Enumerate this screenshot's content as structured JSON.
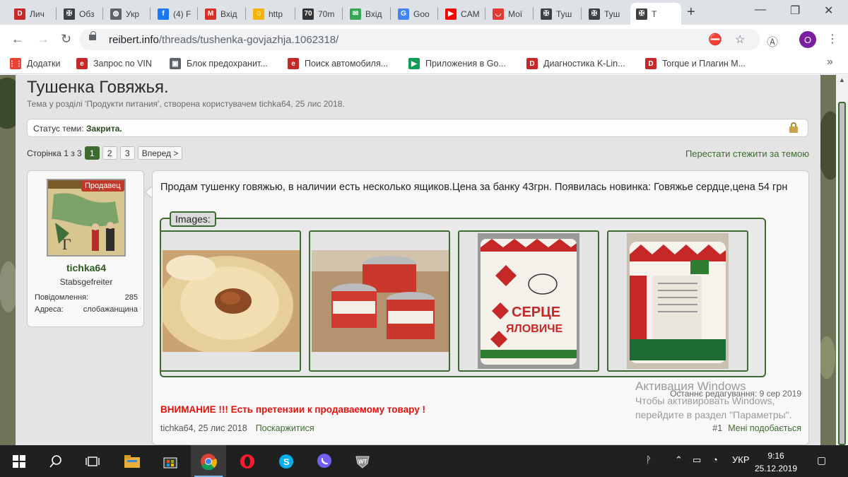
{
  "browser": {
    "tabs": [
      {
        "label": "Лич",
        "fav": "D",
        "color": "#c62828"
      },
      {
        "label": "Обз",
        "fav": "✠",
        "color": "#3c4043"
      },
      {
        "label": "Укр",
        "fav": "◍",
        "color": "#5f6368"
      },
      {
        "label": "(4) F",
        "fav": "f",
        "color": "#1877f2"
      },
      {
        "label": "Вхід",
        "fav": "M",
        "color": "#d93025"
      },
      {
        "label": "http",
        "fav": "☺",
        "color": "#f4b400"
      },
      {
        "label": "70m",
        "fav": "70",
        "color": "#333333"
      },
      {
        "label": "Вхід",
        "fav": "✉",
        "color": "#34a853"
      },
      {
        "label": "Goo",
        "fav": "G",
        "color": "#4285f4"
      },
      {
        "label": "CAM",
        "fav": "▶",
        "color": "#ff0000"
      },
      {
        "label": "Мої",
        "fav": "◡",
        "color": "#e53935"
      },
      {
        "label": "Туш",
        "fav": "✠",
        "color": "#3c4043"
      },
      {
        "label": "Туш",
        "fav": "✠",
        "color": "#3c4043"
      },
      {
        "label": "Т",
        "fav": "✠",
        "color": "#3c4043"
      }
    ],
    "new_tab": "+",
    "window_controls": {
      "minimize": "—",
      "maximize": "❐",
      "close": "✕"
    },
    "nav": {
      "back": "←",
      "forward": "→",
      "reload": "↻"
    },
    "url_host": "reibert.info",
    "url_path": "/threads/tushenka-govjazhja.1062318/",
    "profile_initial": "O",
    "bookmarks": [
      {
        "label": "Додатки",
        "icon": "apps-icon"
      },
      {
        "label": "Запрос по VIN",
        "icon": "e-icon"
      },
      {
        "label": "Блок предохранит...",
        "icon": "car-icon"
      },
      {
        "label": "Поиск автомобиля...",
        "icon": "e-icon"
      },
      {
        "label": "Приложения в Go...",
        "icon": "play-icon"
      },
      {
        "label": "Диагностика K-Lin...",
        "icon": "d-icon"
      },
      {
        "label": "Torque и Плагин М...",
        "icon": "d-icon"
      }
    ],
    "bookmarks_more": "»"
  },
  "thread": {
    "title": "Тушенка Говяжья.",
    "subtitle": "Тема у розділі 'Продукти питания', створена користувачем tichka64, 25 лис 2018.",
    "status_label": "Статус теми: ",
    "status_value": "Закрита.",
    "pager_label": "Сторінка 1 з 3",
    "pages": [
      "1",
      "2",
      "3"
    ],
    "next_label": "Вперед >",
    "unwatch_label": "Перестати стежити за темою"
  },
  "user": {
    "badge": "Продавец",
    "name": "tichka64",
    "rank": "Stabsgefreiter",
    "messages_label": "Повідомлення:",
    "messages_value": "285",
    "address_label": "Адреса:",
    "address_value": "слобажанщина"
  },
  "post": {
    "text": "Продам тушенку говяжью, в наличии есть несколько ящиков.Цена за банку 43грн. Появилась новинка: Говяжье сердце,цена 54 грн",
    "images_legend": "Images:",
    "can_text_1": "СЕРЦЕ",
    "can_text_2": "ЯЛОВИЧЕ",
    "last_edit": "Останнє редагування: 9 сер 2019",
    "warning": "ВНИМАНИЕ !!! Есть претензии к продаваемому товару !",
    "author_date": "tichka64, 25 лис 2018",
    "report": "Поскаржитися",
    "post_number": "#1",
    "like": "Мені подобається"
  },
  "activation": {
    "line1": "Активация Windows",
    "line2": "Чтобы активировать Windows,",
    "line3": "перейдите в раздел \"Параметры\"."
  },
  "taskbar": {
    "lang": "УКР",
    "time": "9:16",
    "date": "25.12.2019"
  }
}
